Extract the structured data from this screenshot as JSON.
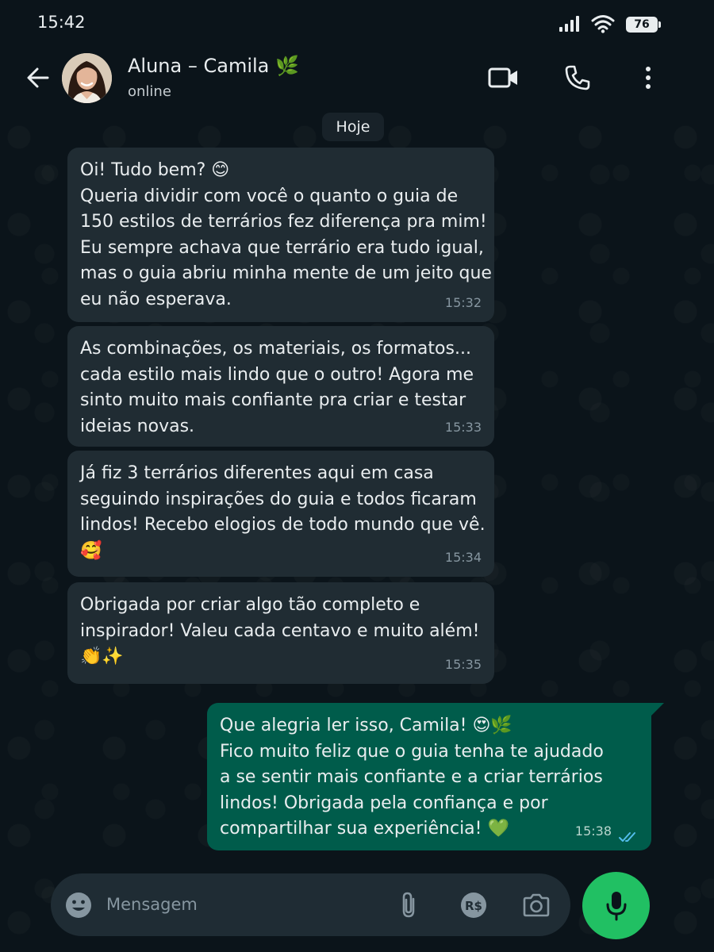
{
  "status_bar": {
    "time": "15:42",
    "battery": "76"
  },
  "header": {
    "contact_name": "Aluna – Camila 🌿",
    "contact_status": "online"
  },
  "chat": {
    "date_label": "Hoje",
    "messages": [
      {
        "direction": "in",
        "lines": [
          "Oi! Tudo bem? 😊",
          "Queria dividir com você o quanto o guia de",
          "150 estilos de terrários fez diferença pra mim!",
          "Eu sempre achava que terrário era tudo igual,",
          "mas o guia abriu minha mente de um jeito que",
          "eu não esperava."
        ],
        "time": "15:32"
      },
      {
        "direction": "in",
        "lines": [
          "As combinações, os materiais, os formatos...",
          "cada estilo mais lindo que o outro! Agora me",
          "sinto muito mais confiante pra criar e testar",
          "ideias novas."
        ],
        "time": "15:33"
      },
      {
        "direction": "in",
        "lines": [
          "Já fiz 3 terrários diferentes aqui em casa",
          "seguindo inspirações do guia e todos ficaram",
          "lindos! Recebo elogios de todo mundo que vê.",
          "🥰"
        ],
        "time": "15:34"
      },
      {
        "direction": "in",
        "lines": [
          "Obrigada por criar algo tão completo e",
          "inspirador! Valeu cada centavo e muito além!",
          "👏✨"
        ],
        "time": "15:35"
      },
      {
        "direction": "out",
        "lines": [
          "Que alegria ler isso, Camila! 😍🌿",
          "Fico muito feliz que o guia tenha te ajudado",
          "a se sentir mais confiante e a criar terrários",
          "lindos! Obrigada pela confiança e por",
          "compartilhar sua experiência! 💚"
        ],
        "time": "15:38",
        "read": true
      }
    ]
  },
  "composer": {
    "placeholder": "Mensagem"
  },
  "icons": {
    "back": "arrow-left-icon",
    "video": "video-camera-icon",
    "call": "phone-icon",
    "menu": "kebab-menu-icon",
    "emoji": "emoji-icon",
    "attach": "paperclip-icon",
    "payment": "brl-payment-icon",
    "camera": "camera-icon",
    "mic": "microphone-icon"
  },
  "colors": {
    "background": "#0b141a",
    "incoming_bubble": "#202c33",
    "outgoing_bubble": "#005c4b",
    "accent": "#21c063",
    "read_ticks": "#53bdeb"
  }
}
